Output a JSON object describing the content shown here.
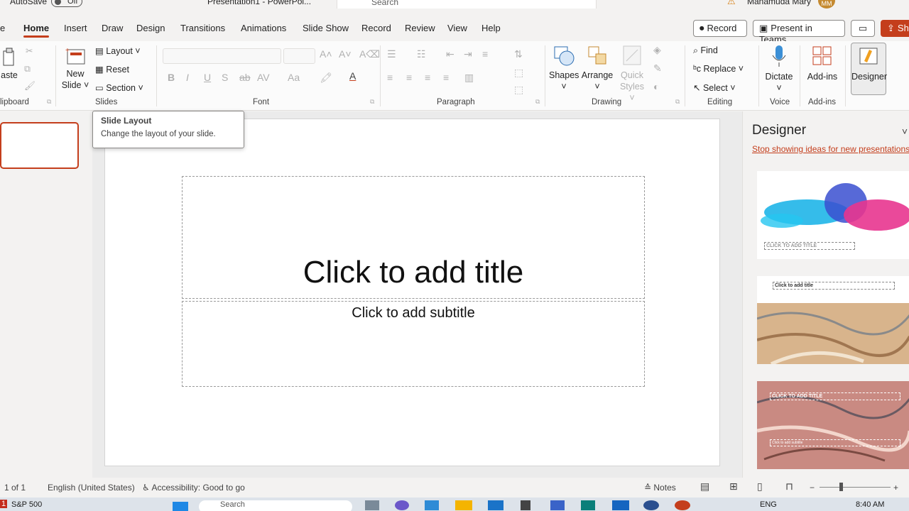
{
  "titlebar": {
    "autosave": "AutoSave",
    "toggle": "Off",
    "title": "Presentation1 - PowerPoi...",
    "search_placeholder": "Search",
    "user": "Manamuda Mary",
    "avatar": "MM"
  },
  "tabs": [
    {
      "label": "e"
    },
    {
      "label": "Home"
    },
    {
      "label": "Insert"
    },
    {
      "label": "Draw"
    },
    {
      "label": "Design"
    },
    {
      "label": "Transitions"
    },
    {
      "label": "Animations"
    },
    {
      "label": "Slide Show"
    },
    {
      "label": "Record"
    },
    {
      "label": "Review"
    },
    {
      "label": "View"
    },
    {
      "label": "Help"
    }
  ],
  "top_buttons": {
    "record": "Record",
    "present": "Present in Teams",
    "share": "Sh"
  },
  "ribbon": {
    "clipboard": {
      "paste": "aste",
      "label": "lipboard"
    },
    "slides": {
      "new_slide": "New",
      "new_slide2": "Slide",
      "layout": "Layout",
      "reset": "Reset",
      "section": "Section",
      "label": "Slides"
    },
    "font": {
      "label": "Font"
    },
    "paragraph": {
      "label": "Paragraph"
    },
    "drawing": {
      "shapes": "Shapes",
      "arrange": "Arrange",
      "quick_styles": "Quick",
      "quick_styles2": "Styles",
      "label": "Drawing"
    },
    "editing": {
      "find": "Find",
      "replace": "Replace",
      "select": "Select",
      "label": "Editing"
    },
    "voice": {
      "dictate": "Dictate",
      "label": "Voice"
    },
    "addins": {
      "addins": "Add-ins",
      "label": "Add-ins"
    },
    "designer": {
      "designer": "Designer"
    }
  },
  "tooltip": {
    "heading": "Slide Layout",
    "desc": "Change the layout of your slide."
  },
  "slide": {
    "title_placeholder": "Click to add title",
    "subtitle_placeholder": "Click to add subtitle"
  },
  "designer_pane": {
    "heading": "Designer",
    "link": "Stop showing ideas for new presentations",
    "cards": [
      {
        "text": "CLICK TO ADD TITLE"
      },
      {
        "text": "Click to add title"
      },
      {
        "text": "CLICK TO ADD TITLE",
        "sub": "Click to add subtitle"
      }
    ]
  },
  "statusbar": {
    "slide_count": "1 of 1",
    "language": "English (United States)",
    "accessibility": "Accessibility: Good to go",
    "notes": "Notes"
  },
  "taskbar": {
    "stock": "S&P 500",
    "search": "Search",
    "lang": "ENG",
    "time": "8:40 AM"
  },
  "colors": {
    "accent": "#c43e1c",
    "link": "#c43e1c"
  }
}
